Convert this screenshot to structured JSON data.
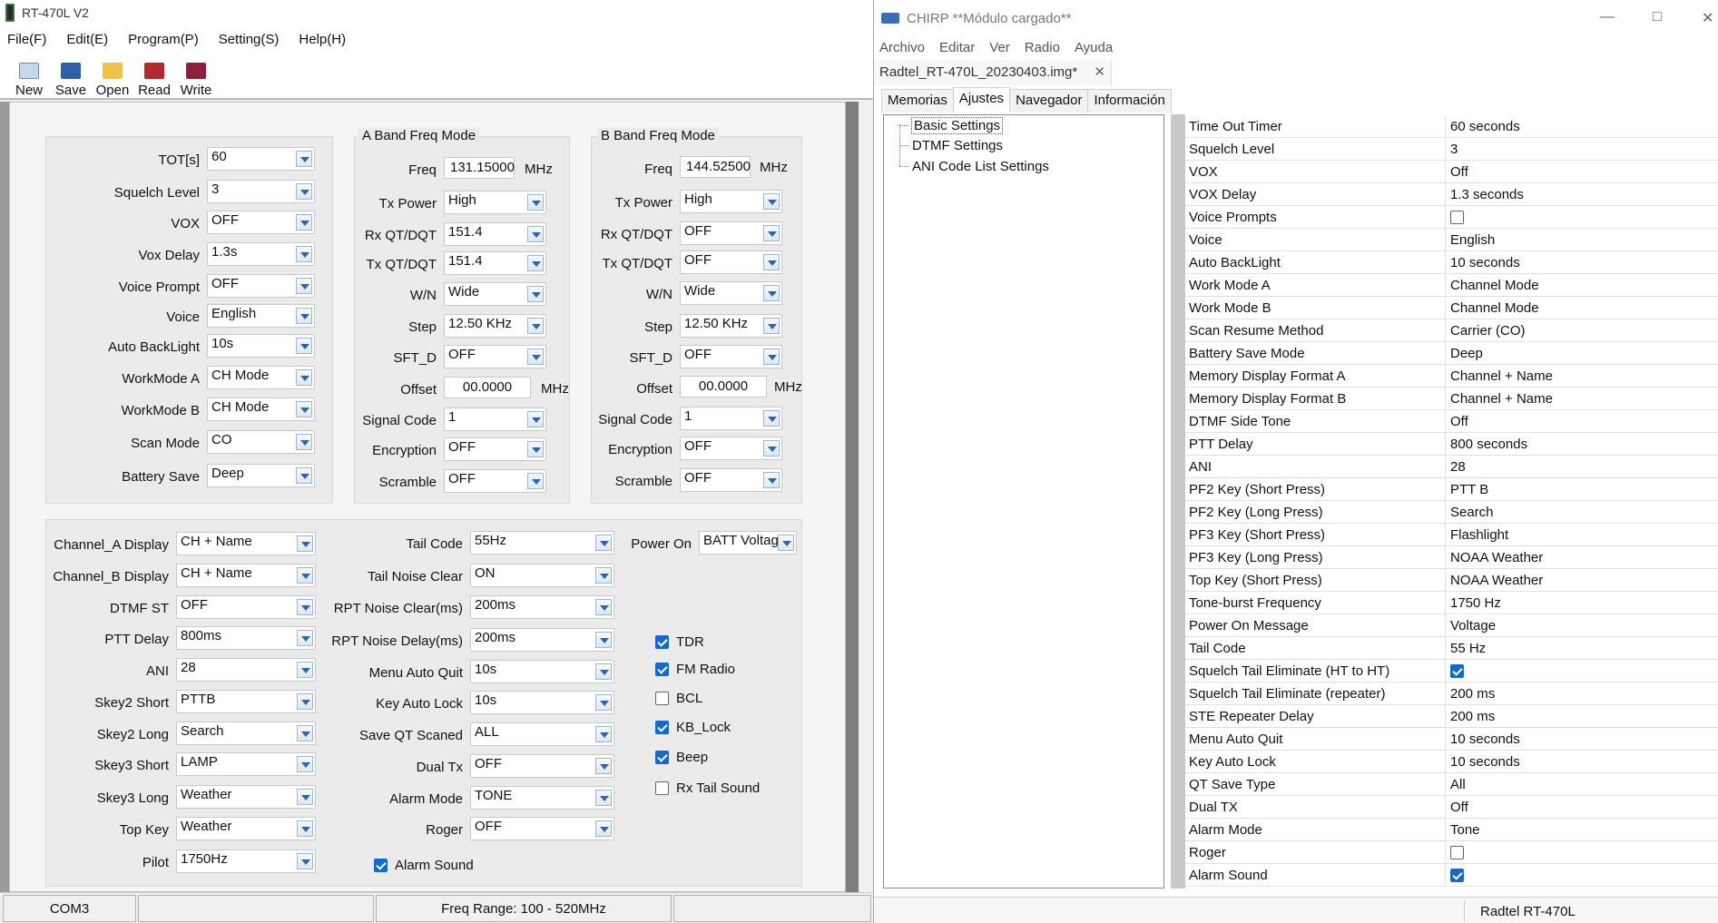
{
  "left": {
    "title": "RT-470L V2",
    "menu": [
      "File(F)",
      "Edit(E)",
      "Program(P)",
      "Setting(S)",
      "Help(H)"
    ],
    "toolbar": [
      "New",
      "Save",
      "Open",
      "Read",
      "Write"
    ],
    "general": {
      "tot": {
        "label": "TOT[s]",
        "value": "60"
      },
      "squelch": {
        "label": "Squelch Level",
        "value": "3"
      },
      "vox": {
        "label": "VOX",
        "value": "OFF"
      },
      "vox_delay": {
        "label": "Vox Delay",
        "value": "1.3s"
      },
      "voice_prompt": {
        "label": "Voice Prompt",
        "value": "OFF"
      },
      "voice": {
        "label": "Voice",
        "value": "English"
      },
      "auto_backlight": {
        "label": "Auto BackLight",
        "value": "10s"
      },
      "workmode_a": {
        "label": "WorkMode A",
        "value": "CH Mode"
      },
      "workmode_b": {
        "label": "WorkMode B",
        "value": "CH Mode"
      },
      "scan_mode": {
        "label": "Scan Mode",
        "value": "CO"
      },
      "battery_save": {
        "label": "Battery Save",
        "value": "Deep"
      }
    },
    "band_a": {
      "title": "A Band Freq Mode",
      "freq": {
        "label": "Freq",
        "value": "131.15000",
        "unit": "MHz"
      },
      "tx_power": {
        "label": "Tx Power",
        "value": "High"
      },
      "rx_qt": {
        "label": "Rx QT/DQT",
        "value": "151.4"
      },
      "tx_qt": {
        "label": "Tx QT/DQT",
        "value": "151.4"
      },
      "wn": {
        "label": "W/N",
        "value": "Wide"
      },
      "step": {
        "label": "Step",
        "value": "12.50 KHz"
      },
      "sft_d": {
        "label": "SFT_D",
        "value": "OFF"
      },
      "offset": {
        "label": "Offset",
        "value": "00.0000",
        "unit": "MHz"
      },
      "signal_code": {
        "label": "Signal Code",
        "value": "1"
      },
      "encryption": {
        "label": "Encryption",
        "value": "OFF"
      },
      "scramble": {
        "label": "Scramble",
        "value": "OFF"
      }
    },
    "band_b": {
      "title": "B Band Freq Mode",
      "freq": {
        "label": "Freq",
        "value": "144.52500",
        "unit": "MHz"
      },
      "tx_power": {
        "label": "Tx Power",
        "value": "High"
      },
      "rx_qt": {
        "label": "Rx QT/DQT",
        "value": "OFF"
      },
      "tx_qt": {
        "label": "Tx QT/DQT",
        "value": "OFF"
      },
      "wn": {
        "label": "W/N",
        "value": "Wide"
      },
      "step": {
        "label": "Step",
        "value": "12.50 KHz"
      },
      "sft_d": {
        "label": "SFT_D",
        "value": "OFF"
      },
      "offset": {
        "label": "Offset",
        "value": "00.0000",
        "unit": "MHz"
      },
      "signal_code": {
        "label": "Signal Code",
        "value": "1"
      },
      "encryption": {
        "label": "Encryption",
        "value": "OFF"
      },
      "scramble": {
        "label": "Scramble",
        "value": "OFF"
      }
    },
    "lower_col1": {
      "cha_display": {
        "label": "Channel_A Display",
        "value": "CH + Name"
      },
      "chb_display": {
        "label": "Channel_B Display",
        "value": "CH + Name"
      },
      "dtmf_st": {
        "label": "DTMF ST",
        "value": "OFF"
      },
      "ptt_delay": {
        "label": "PTT Delay",
        "value": "800ms"
      },
      "ani": {
        "label": "ANI",
        "value": "28"
      },
      "skey2_short": {
        "label": "Skey2 Short",
        "value": "PTTB"
      },
      "skey2_long": {
        "label": "Skey2 Long",
        "value": "Search"
      },
      "skey3_short": {
        "label": "Skey3 Short",
        "value": "LAMP"
      },
      "skey3_long": {
        "label": "Skey3 Long",
        "value": "Weather"
      },
      "top_key": {
        "label": "Top Key",
        "value": "Weather"
      },
      "pilot": {
        "label": "Pilot",
        "value": "1750Hz"
      }
    },
    "lower_col2": {
      "tail_code": {
        "label": "Tail Code",
        "value": "55Hz"
      },
      "tail_noise_clear": {
        "label": "Tail Noise Clear",
        "value": "ON"
      },
      "rpt_noise_clear": {
        "label": "RPT Noise Clear(ms)",
        "value": "200ms"
      },
      "rpt_noise_delay": {
        "label": "RPT Noise Delay(ms)",
        "value": "200ms"
      },
      "menu_auto_quit": {
        "label": "Menu Auto Quit",
        "value": "10s"
      },
      "key_auto_lock": {
        "label": "Key Auto Lock",
        "value": "10s"
      },
      "save_qt": {
        "label": "Save QT Scaned",
        "value": "ALL"
      },
      "dual_tx": {
        "label": "Dual Tx",
        "value": "OFF"
      },
      "alarm_mode": {
        "label": "Alarm Mode",
        "value": "TONE"
      },
      "roger": {
        "label": "Roger",
        "value": "OFF"
      }
    },
    "power_on": {
      "label": "Power On",
      "value": "BATT Voltag"
    },
    "checks": {
      "tdr": {
        "label": "TDR",
        "checked": true
      },
      "fm_radio": {
        "label": "FM Radio",
        "checked": true
      },
      "bcl": {
        "label": "BCL",
        "checked": false
      },
      "kb_lock": {
        "label": "KB_Lock",
        "checked": true
      },
      "beep": {
        "label": "Beep",
        "checked": true
      },
      "rx_tail": {
        "label": "Rx Tail Sound",
        "checked": false
      },
      "alarm_sound": {
        "label": "Alarm Sound",
        "checked": true
      }
    },
    "status": {
      "port": "COM3",
      "range": "Freq Range: 100 - 520MHz"
    }
  },
  "right": {
    "title": "CHIRP **Módulo cargado**",
    "menu": [
      "Archivo",
      "Editar",
      "Ver",
      "Radio",
      "Ayuda"
    ],
    "file_tab": "Radtel_RT-470L_20230403.img*",
    "tabs": [
      "Memorias",
      "Ajustes",
      "Navegador",
      "Información"
    ],
    "tree": [
      "Basic Settings",
      "DTMF Settings",
      "ANI Code List Settings"
    ],
    "settings": [
      {
        "k": "Time Out Timer",
        "v": "60 seconds"
      },
      {
        "k": "Squelch Level",
        "v": "3"
      },
      {
        "k": "VOX",
        "v": "Off"
      },
      {
        "k": "VOX Delay",
        "v": "1.3 seconds"
      },
      {
        "k": "Voice Prompts",
        "check": false
      },
      {
        "k": "Voice",
        "v": "English"
      },
      {
        "k": "Auto BackLight",
        "v": "10 seconds"
      },
      {
        "k": "Work Mode A",
        "v": "Channel Mode"
      },
      {
        "k": "Work Mode B",
        "v": "Channel Mode"
      },
      {
        "k": "Scan Resume Method",
        "v": "Carrier (CO)"
      },
      {
        "k": "Battery Save Mode",
        "v": "Deep"
      },
      {
        "k": "Memory Display Format A",
        "v": "Channel + Name"
      },
      {
        "k": "Memory Display Format B",
        "v": "Channel + Name"
      },
      {
        "k": "DTMF Side Tone",
        "v": "Off"
      },
      {
        "k": "PTT Delay",
        "v": "800 seconds"
      },
      {
        "k": "ANI",
        "v": "28"
      },
      {
        "k": "PF2 Key (Short Press)",
        "v": "PTT B"
      },
      {
        "k": "PF2 Key (Long Press)",
        "v": "Search"
      },
      {
        "k": "PF3 Key (Short Press)",
        "v": "Flashlight"
      },
      {
        "k": "PF3 Key (Long Press)",
        "v": "NOAA Weather"
      },
      {
        "k": "Top Key (Short Press)",
        "v": "NOAA Weather"
      },
      {
        "k": "Tone-burst Frequency",
        "v": "1750 Hz"
      },
      {
        "k": "Power On Message",
        "v": "Voltage"
      },
      {
        "k": "Tail Code",
        "v": "55 Hz"
      },
      {
        "k": "Squelch Tail Eliminate (HT to HT)",
        "check": true
      },
      {
        "k": "Squelch Tail Eliminate (repeater)",
        "v": "200 ms"
      },
      {
        "k": "STE Repeater Delay",
        "v": "200 ms"
      },
      {
        "k": "Menu Auto Quit",
        "v": "10 seconds"
      },
      {
        "k": "Key Auto Lock",
        "v": "10 seconds"
      },
      {
        "k": "QT Save Type",
        "v": "All"
      },
      {
        "k": "Dual TX",
        "v": "Off"
      },
      {
        "k": "Alarm Mode",
        "v": "Tone"
      },
      {
        "k": "Roger",
        "check": false
      },
      {
        "k": "Alarm Sound",
        "check": true
      }
    ],
    "status": "Radtel RT-470L"
  }
}
